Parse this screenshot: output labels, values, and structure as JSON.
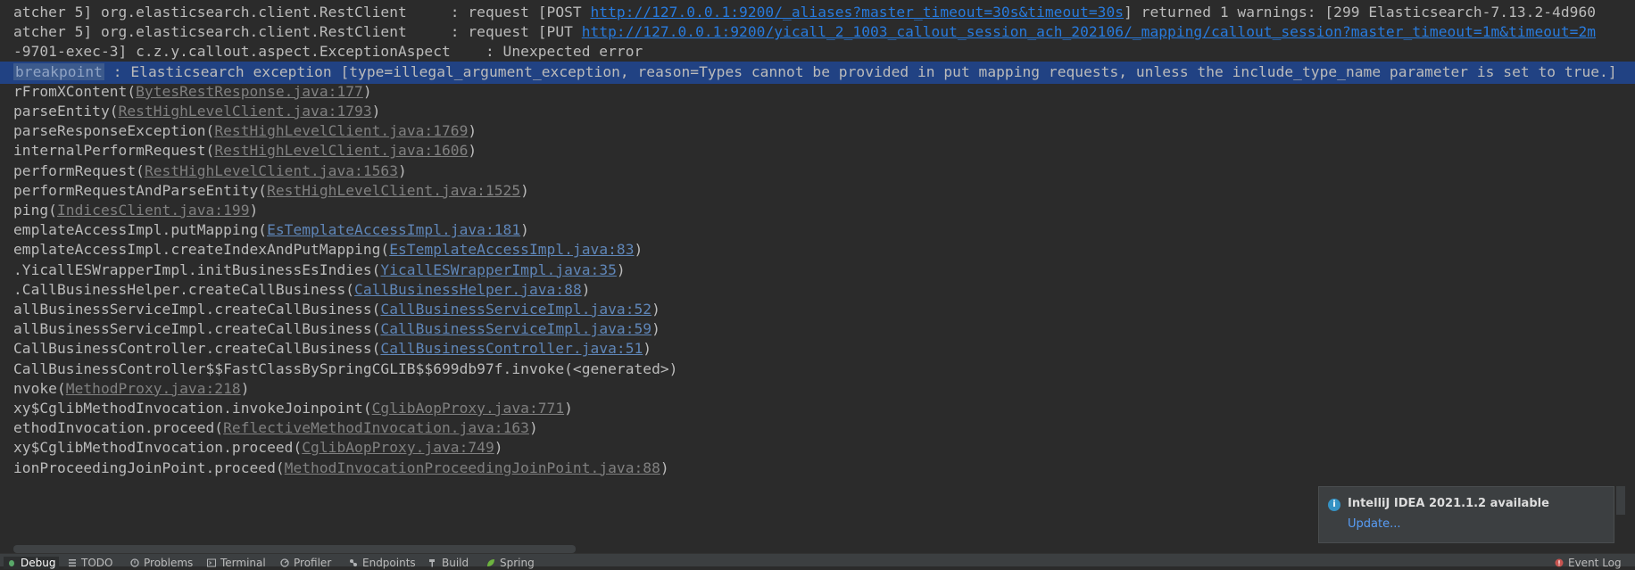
{
  "console": {
    "lines": [
      {
        "segments": [
          {
            "text": "atcher 5] org.elasticsearch.client.RestClient     : request [POST ",
            "style": "plain"
          },
          {
            "text": "http://127.0.0.1:9200/_aliases?master_timeout=30s&timeout=30s",
            "style": "url"
          },
          {
            "text": "] returned 1 warnings: [299 Elasticsearch-7.13.2-4d960",
            "style": "plain"
          }
        ]
      },
      {
        "segments": [
          {
            "text": "atcher 5] org.elasticsearch.client.RestClient     : request [PUT ",
            "style": "plain"
          },
          {
            "text": "http://127.0.0.1:9200/yicall_2_1003_callout_session_ach_202106/_mapping/callout_session?master_timeout=1m&timeout=2m",
            "style": "url"
          }
        ]
      },
      {
        "segments": [
          {
            "text": "-9701-exec-3] c.z.y.callout.aspect.ExceptionAspect    : Unexpected error",
            "style": "plain"
          }
        ]
      },
      {
        "segments": [
          {
            "text": "breakpoint",
            "style": "bp"
          },
          {
            "text": " : Elasticsearch exception [type=illegal_argument_exception, reason=Types cannot be provided in put mapping requests, unless the include_type_name parameter is set to true.]",
            "style": "plain"
          }
        ]
      },
      {
        "segments": [
          {
            "text": "rFromXContent(",
            "style": "plain"
          },
          {
            "text": "BytesRestResponse.java:177",
            "style": "lib"
          },
          {
            "text": ")",
            "style": "plain"
          }
        ]
      },
      {
        "segments": [
          {
            "text": "parseEntity(",
            "style": "plain"
          },
          {
            "text": "RestHighLevelClient.java:1793",
            "style": "lib"
          },
          {
            "text": ")",
            "style": "plain"
          }
        ]
      },
      {
        "segments": [
          {
            "text": "parseResponseException(",
            "style": "plain"
          },
          {
            "text": "RestHighLevelClient.java:1769",
            "style": "lib"
          },
          {
            "text": ")",
            "style": "plain"
          }
        ]
      },
      {
        "segments": [
          {
            "text": "internalPerformRequest(",
            "style": "plain"
          },
          {
            "text": "RestHighLevelClient.java:1606",
            "style": "lib"
          },
          {
            "text": ")",
            "style": "plain"
          }
        ]
      },
      {
        "segments": [
          {
            "text": "performRequest(",
            "style": "plain"
          },
          {
            "text": "RestHighLevelClient.java:1563",
            "style": "lib"
          },
          {
            "text": ")",
            "style": "plain"
          }
        ]
      },
      {
        "segments": [
          {
            "text": "performRequestAndParseEntity(",
            "style": "plain"
          },
          {
            "text": "RestHighLevelClient.java:1525",
            "style": "lib"
          },
          {
            "text": ")",
            "style": "plain"
          }
        ]
      },
      {
        "segments": [
          {
            "text": "ping(",
            "style": "plain"
          },
          {
            "text": "IndicesClient.java:199",
            "style": "lib"
          },
          {
            "text": ")",
            "style": "plain"
          }
        ]
      },
      {
        "segments": [
          {
            "text": "emplateAccessImpl.putMapping(",
            "style": "plain"
          },
          {
            "text": "EsTemplateAccessImpl.java:181",
            "style": "ide"
          },
          {
            "text": ")",
            "style": "plain"
          }
        ]
      },
      {
        "segments": [
          {
            "text": "emplateAccessImpl.createIndexAndPutMapping(",
            "style": "plain"
          },
          {
            "text": "EsTemplateAccessImpl.java:83",
            "style": "ide"
          },
          {
            "text": ")",
            "style": "plain"
          }
        ]
      },
      {
        "segments": [
          {
            "text": ".YicallESWrapperImpl.initBusinessEsIndies(",
            "style": "plain"
          },
          {
            "text": "YicallESWrapperImpl.java:35",
            "style": "ide"
          },
          {
            "text": ")",
            "style": "plain"
          }
        ]
      },
      {
        "segments": [
          {
            "text": ".CallBusinessHelper.createCallBusiness(",
            "style": "plain"
          },
          {
            "text": "CallBusinessHelper.java:88",
            "style": "ide"
          },
          {
            "text": ")",
            "style": "plain"
          }
        ]
      },
      {
        "segments": [
          {
            "text": "allBusinessServiceImpl.createCallBusiness(",
            "style": "plain"
          },
          {
            "text": "CallBusinessServiceImpl.java:52",
            "style": "ide"
          },
          {
            "text": ")",
            "style": "plain"
          }
        ]
      },
      {
        "segments": [
          {
            "text": "allBusinessServiceImpl.createCallBusiness(",
            "style": "plain"
          },
          {
            "text": "CallBusinessServiceImpl.java:59",
            "style": "ide"
          },
          {
            "text": ")",
            "style": "plain"
          }
        ]
      },
      {
        "segments": [
          {
            "text": "CallBusinessController.createCallBusiness(",
            "style": "plain"
          },
          {
            "text": "CallBusinessController.java:51",
            "style": "ide"
          },
          {
            "text": ")",
            "style": "plain"
          }
        ]
      },
      {
        "segments": [
          {
            "text": "CallBusinessController$$FastClassBySpringCGLIB$$699db97f.invoke(<generated>)",
            "style": "plain"
          }
        ]
      },
      {
        "segments": [
          {
            "text": "nvoke(",
            "style": "plain"
          },
          {
            "text": "MethodProxy.java:218",
            "style": "lib"
          },
          {
            "text": ")",
            "style": "plain"
          }
        ]
      },
      {
        "segments": [
          {
            "text": "xy$CglibMethodInvocation.invokeJoinpoint(",
            "style": "plain"
          },
          {
            "text": "CglibAopProxy.java:771",
            "style": "lib"
          },
          {
            "text": ")",
            "style": "plain"
          }
        ]
      },
      {
        "segments": [
          {
            "text": "ethodInvocation.proceed(",
            "style": "plain"
          },
          {
            "text": "ReflectiveMethodInvocation.java:163",
            "style": "lib"
          },
          {
            "text": ")",
            "style": "plain"
          }
        ]
      },
      {
        "segments": [
          {
            "text": "xy$CglibMethodInvocation.proceed(",
            "style": "plain"
          },
          {
            "text": "CglibAopProxy.java:749",
            "style": "lib"
          },
          {
            "text": ")",
            "style": "plain"
          }
        ]
      },
      {
        "segments": [
          {
            "text": "ionProceedingJoinPoint.proceed(",
            "style": "plain"
          },
          {
            "text": "MethodInvocationProceedingJoinPoint.java:88",
            "style": "lib"
          },
          {
            "text": ")",
            "style": "plain"
          }
        ]
      }
    ]
  },
  "notification": {
    "title": "IntelliJ IDEA 2021.1.2 available",
    "action": "Update..."
  },
  "toolbar": {
    "items": [
      {
        "label": "Debug",
        "icon": "bug-icon"
      },
      {
        "label": "TODO",
        "icon": "list-icon"
      },
      {
        "label": "Problems",
        "icon": "problems-icon"
      },
      {
        "label": "Terminal",
        "icon": "terminal-icon"
      },
      {
        "label": "Profiler",
        "icon": "profiler-icon"
      },
      {
        "label": "Endpoints",
        "icon": "endpoints-icon"
      },
      {
        "label": "Build",
        "icon": "hammer-icon"
      },
      {
        "label": "Spring",
        "icon": "spring-icon"
      }
    ],
    "event_log": {
      "label": "Event Log",
      "icon": "event-log-icon",
      "badge_color": "#c75450"
    }
  },
  "colors": {
    "background": "#2b2b2b",
    "selection": "#214283",
    "link_project": "#5f86b8",
    "link_library": "#808080",
    "link_url": "#287bde"
  }
}
